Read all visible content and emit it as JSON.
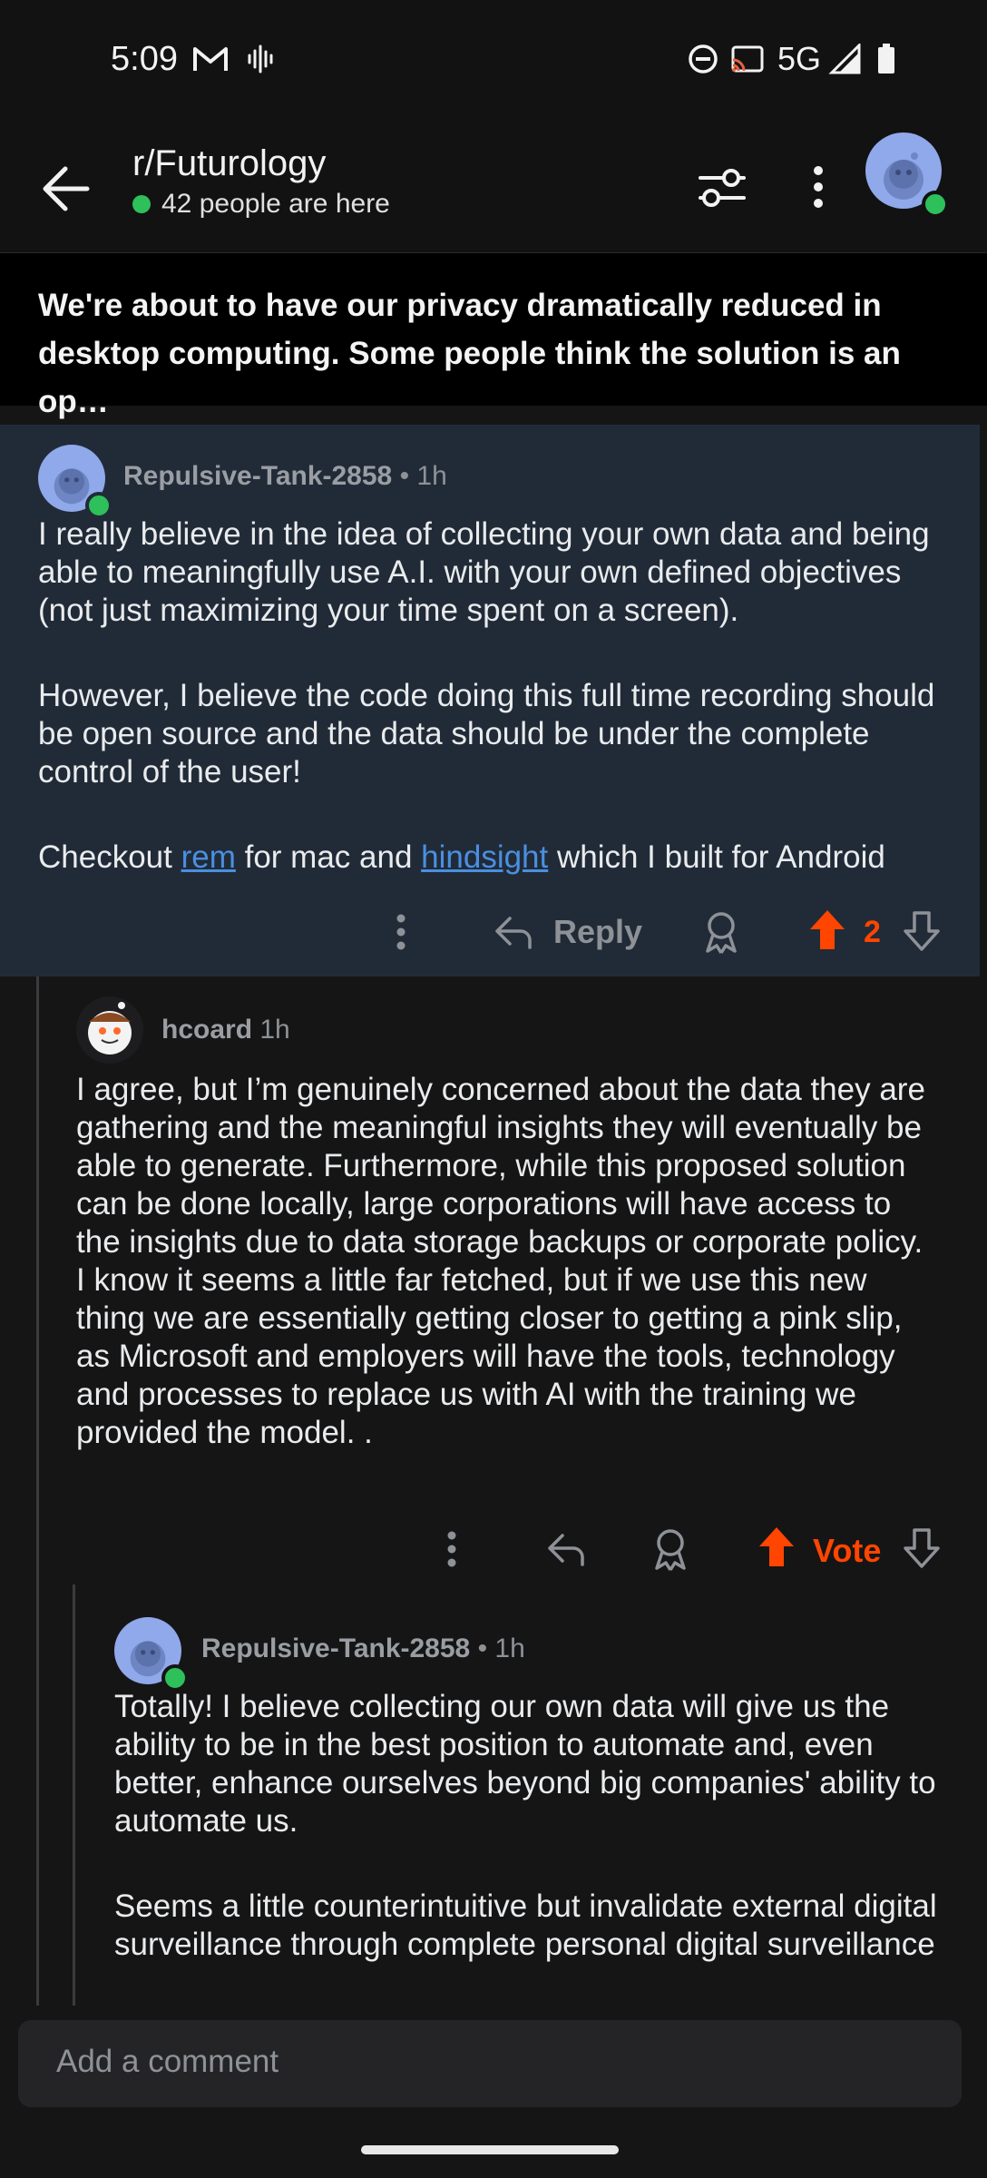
{
  "status_bar": {
    "time": "5:09",
    "network": "5G",
    "icons": [
      "gmail-icon",
      "voicemail-icon",
      "dnd-icon",
      "cast-icon",
      "signal-icon",
      "battery-icon"
    ]
  },
  "header": {
    "subreddit": "r/Futurology",
    "presence": "42 people are here",
    "icons": [
      "back-arrow-icon",
      "filter-icon",
      "more-vertical-icon",
      "avatar"
    ]
  },
  "post": {
    "title": "We're about to have our privacy dramatically reduced in desktop computing. Some people think the solution is an op…"
  },
  "comments": [
    {
      "author": "Repulsive-Tank-2858",
      "age": "• 1h",
      "paragraphs": [
        "I really believe in the idea of collecting your own data and being able to meaningfully use A.I. with your own defined objectives (not just maximizing your time spent on a screen).",
        "However, I believe the code doing this full time recording should be open source and the data should be under the complete control of the user!"
      ],
      "checkout_prefix": "Checkout ",
      "link1": "rem",
      "middle": " for mac and ",
      "link2": "hindsight",
      "suffix": " which I built for Android",
      "reply_label": "Reply",
      "votes": "2"
    },
    {
      "author": "hcoard",
      "age": "1h",
      "text": "I agree, but I’m genuinely concerned about the data they are gathering and the meaningful insights they will eventually be able to generate. Furthermore, while this proposed solution can be done locally, large corporations will have access to the insights due to data storage backups or corporate policy. I know it seems a little far fetched, but if we use this new thing we are essentially getting closer to getting a pink slip, as Microsoft and employers will have the tools, technology and processes to replace us with AI with the training we provided the model. .",
      "vote_label": "Vote"
    },
    {
      "author": "Repulsive-Tank-2858",
      "age": "• 1h",
      "paragraphs": [
        "Totally! I believe collecting our own data will give us the ability to be in the best position to automate and, even better, enhance ourselves beyond big companies' ability to automate us.",
        "Seems a little counterintuitive but invalidate external digital surveillance through complete personal digital surveillance"
      ]
    }
  ],
  "comment_bar": {
    "placeholder": "Add a comment"
  },
  "colors": {
    "upvote": "#ff4500",
    "highlight_bg": "#212b38",
    "link": "#4a8fe0",
    "online": "#2ec05a"
  }
}
